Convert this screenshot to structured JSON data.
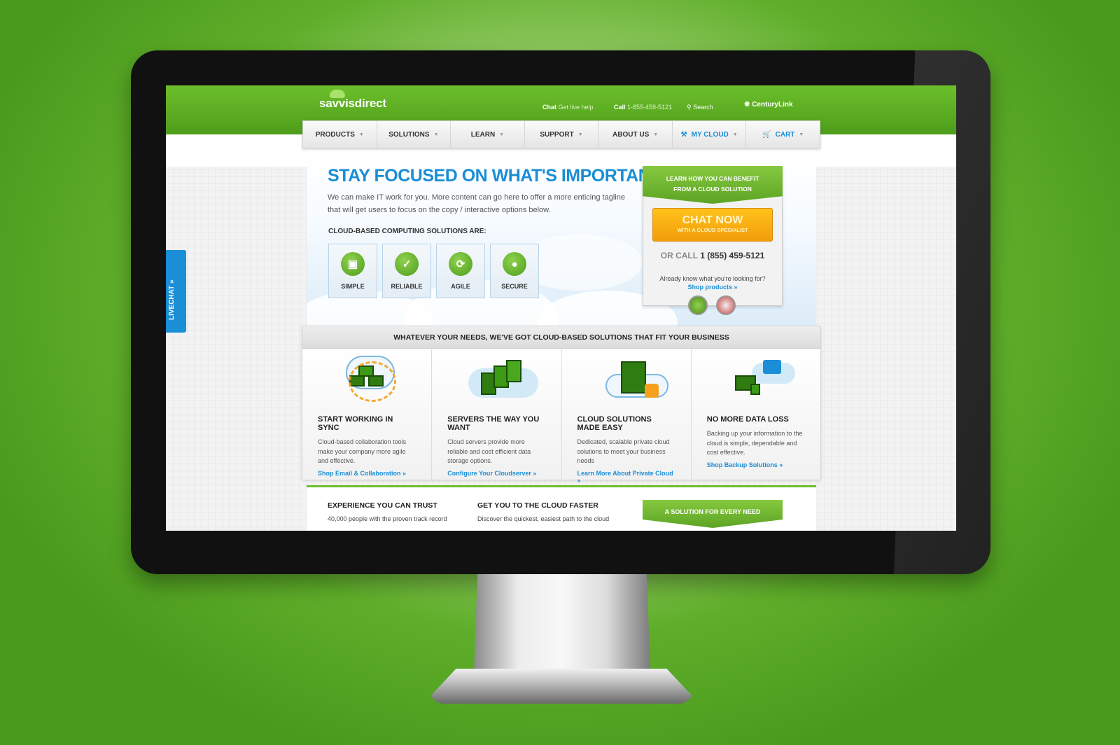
{
  "brand": {
    "logo": "savvisdirect",
    "partner": "CenturyLink"
  },
  "utility": {
    "chat_label": "Chat",
    "chat_sub": "Get live help",
    "call_label": "Call",
    "call_number": "1-855-459-5121",
    "search_label": "Search"
  },
  "nav": {
    "items": [
      {
        "label": "PRODUCTS"
      },
      {
        "label": "SOLUTIONS"
      },
      {
        "label": "LEARN"
      },
      {
        "label": "SUPPORT"
      },
      {
        "label": "ABOUT US"
      },
      {
        "label": "MY CLOUD"
      },
      {
        "label": "CART"
      }
    ]
  },
  "hero": {
    "title": "STAY FOCUSED ON WHAT'S IMPORTANT",
    "tagline": "We can make IT work for you. More content can go here to offer a more enticing tagline that will get users to focus on the copy / interactive options below.",
    "features_label": "CLOUD-BASED COMPUTING SOLUTIONS ARE:",
    "features": [
      {
        "label": "SIMPLE",
        "icon": "cube-icon"
      },
      {
        "label": "RELIABLE",
        "icon": "checkbox-icon"
      },
      {
        "label": "AGILE",
        "icon": "refresh-icon"
      },
      {
        "label": "SECURE",
        "icon": "lock-icon"
      }
    ]
  },
  "cta": {
    "banner_line1": "LEARN HOW YOU CAN BENEFIT",
    "banner_line2": "FROM A CLOUD SOLUTION",
    "chat_title": "CHAT NOW",
    "chat_sub": "WITH A CLOUD SPECIALIST",
    "or_call": "OR CALL",
    "phone": "1 (855) 459-5121",
    "already": "Already know what you're looking for?",
    "shop_link": "Shop products »"
  },
  "solutions": {
    "heading": "WHATEVER YOUR NEEDS, WE'VE GOT CLOUD-BASED SOLUTIONS THAT FIT YOUR BUSINESS",
    "items": [
      {
        "title": "START WORKING IN SYNC",
        "text": "Cloud-based collaboration tools make your company more agile and effective.",
        "link": "Shop Email & Collaboration »"
      },
      {
        "title": "SERVERS THE WAY YOU WANT",
        "text": "Cloud servers provide more reliable and cost efficient data storage options.",
        "link": "Configure Your Cloudserver »"
      },
      {
        "title": "CLOUD SOLUTIONS MADE EASY",
        "text": "Dedicated, scalable private cloud solutions to meet your business needs",
        "link": "Learn More About Private Cloud »"
      },
      {
        "title": "NO MORE DATA LOSS",
        "text": "Backing up your information to the cloud is simple, dependable and cost effective.",
        "link": "Shop Backup Solutions »"
      }
    ]
  },
  "bottom": {
    "col1_title": "EXPERIENCE YOU CAN TRUST",
    "col1_text": "40,000 people with the proven track record",
    "col2_title": "GET YOU TO THE CLOUD FASTER",
    "col2_text": "Discover the quickest, easiest path to the cloud",
    "banner": "A SOLUTION FOR EVERY NEED"
  },
  "livechat": {
    "label": "LIVECHAT »"
  },
  "colors": {
    "brand_green": "#5da424",
    "link_blue": "#1a8ed6",
    "cta_orange": "#f29d0c"
  }
}
